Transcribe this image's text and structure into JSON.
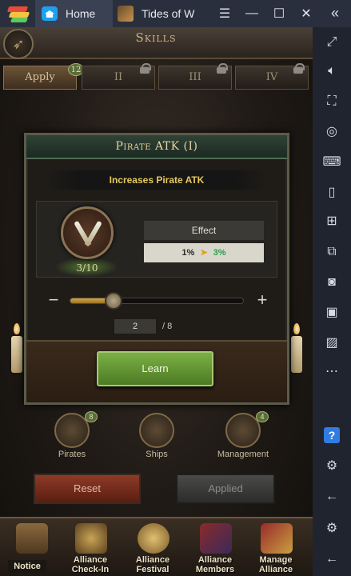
{
  "titlebar": {
    "home_tab": "Home",
    "game_tab": "Tides of W",
    "controls": [
      "☰",
      "—",
      "☐",
      "✕"
    ],
    "collapse": "«"
  },
  "sidebar": {
    "icons": [
      "expand-icon",
      "volume-icon",
      "screenshot-area-icon",
      "eye-off-icon",
      "keyboard-icon",
      "phone-icon",
      "gamepad-icon",
      "folder-icon",
      "camera-icon",
      "video-icon",
      "image-icon",
      "more-icon",
      "help-icon",
      "settings-icon",
      "back-icon"
    ],
    "help_label": "?"
  },
  "game": {
    "title": "Skills",
    "tiers": [
      {
        "label": "Apply",
        "badge": "12"
      },
      {
        "label": "II"
      },
      {
        "label": "III"
      },
      {
        "label": "IV"
      }
    ],
    "dialog": {
      "title": "Pirate ATK (I)",
      "description": "Increases Pirate ATK",
      "level": "3/10",
      "effect_label": "Effect",
      "current_value": "1%",
      "next_value": "3%",
      "slider": {
        "value": 2,
        "max": 8
      },
      "count_value": "2",
      "count_max": "/ 8",
      "learn_label": "Learn"
    },
    "categories": [
      {
        "label": "Pirates",
        "badge": "8"
      },
      {
        "label": "Ships"
      },
      {
        "label": "Management",
        "badge": "4"
      }
    ],
    "reset_label": "Reset",
    "applied_label": "Applied",
    "nav": [
      {
        "label": "Notice"
      },
      {
        "label": "Alliance Check-In"
      },
      {
        "label": "Alliance Festival"
      },
      {
        "label": "Alliance Members"
      },
      {
        "label": "Manage Alliance"
      }
    ]
  },
  "colors": {
    "accent_green": "#7bb045",
    "gold_text": "#e7c85f",
    "reset_red": "#8e3a26"
  }
}
